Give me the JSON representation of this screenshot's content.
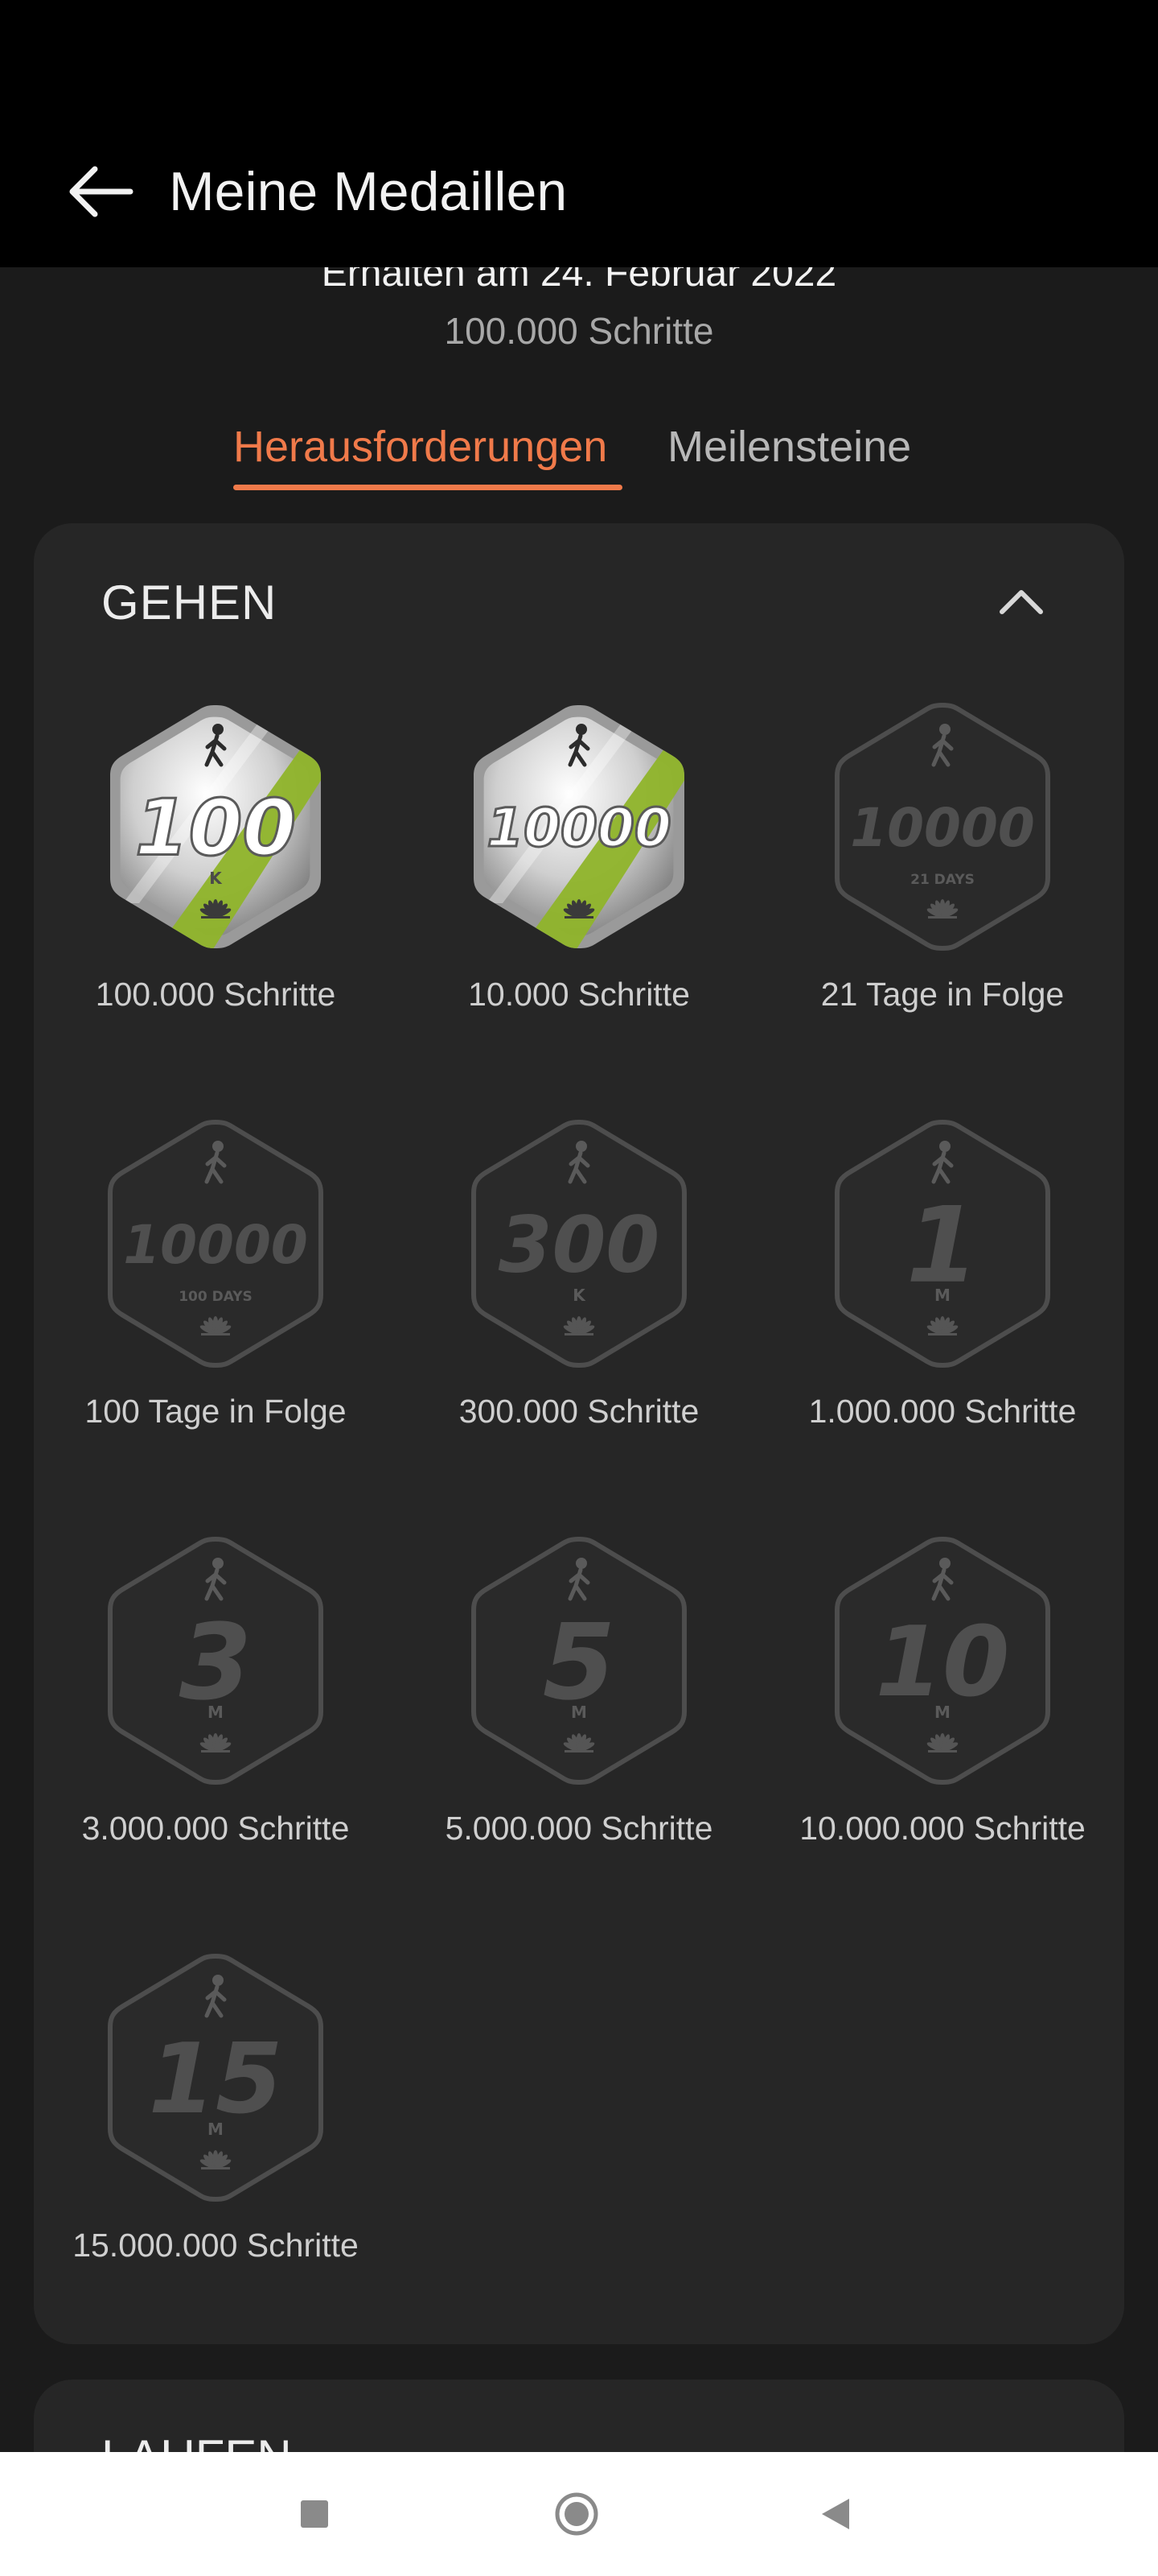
{
  "header": {
    "title": "Meine Medaillen"
  },
  "summary": {
    "earned": "Erhalten am 24. Februar 2022",
    "count": "100.000 Schritte"
  },
  "tabs": [
    {
      "label": "Herausforderungen",
      "active": true
    },
    {
      "label": "Meilensteine",
      "active": false
    }
  ],
  "sections": [
    {
      "title": "GEHEN",
      "expanded": true,
      "medals": [
        {
          "label": "100.000 Schritte",
          "number": "100",
          "unit": "K",
          "earned": true
        },
        {
          "label": "10.000 Schritte",
          "number": "10000",
          "unit": "",
          "earned": true
        },
        {
          "label": "21 Tage in Folge",
          "number": "10000",
          "unit": "21 DAYS",
          "earned": false
        },
        {
          "label": "100 Tage in Folge",
          "number": "10000",
          "unit": "100 DAYS",
          "earned": false
        },
        {
          "label": "300.000 Schritte",
          "number": "300",
          "unit": "K",
          "earned": false
        },
        {
          "label": "1.000.000 Schritte",
          "number": "1",
          "unit": "M",
          "earned": false
        },
        {
          "label": "3.000.000 Schritte",
          "number": "3",
          "unit": "M",
          "earned": false
        },
        {
          "label": "5.000.000 Schritte",
          "number": "5",
          "unit": "M",
          "earned": false
        },
        {
          "label": "10.000.000 Schritte",
          "number": "10",
          "unit": "M",
          "earned": false
        },
        {
          "label": "15.000.000 Schritte",
          "number": "15",
          "unit": "M",
          "earned": false
        }
      ]
    },
    {
      "title": "LAUFEN",
      "expanded": false
    }
  ],
  "colors": {
    "accent": "#f07a4a",
    "earned_stripe": "#8fb42a",
    "locked": "#4a4a4a"
  },
  "icons": {
    "back": "arrow-left-icon",
    "collapse": "chevron-up-icon",
    "nav": [
      "square-icon",
      "circle-icon",
      "triangle-back-icon"
    ]
  }
}
